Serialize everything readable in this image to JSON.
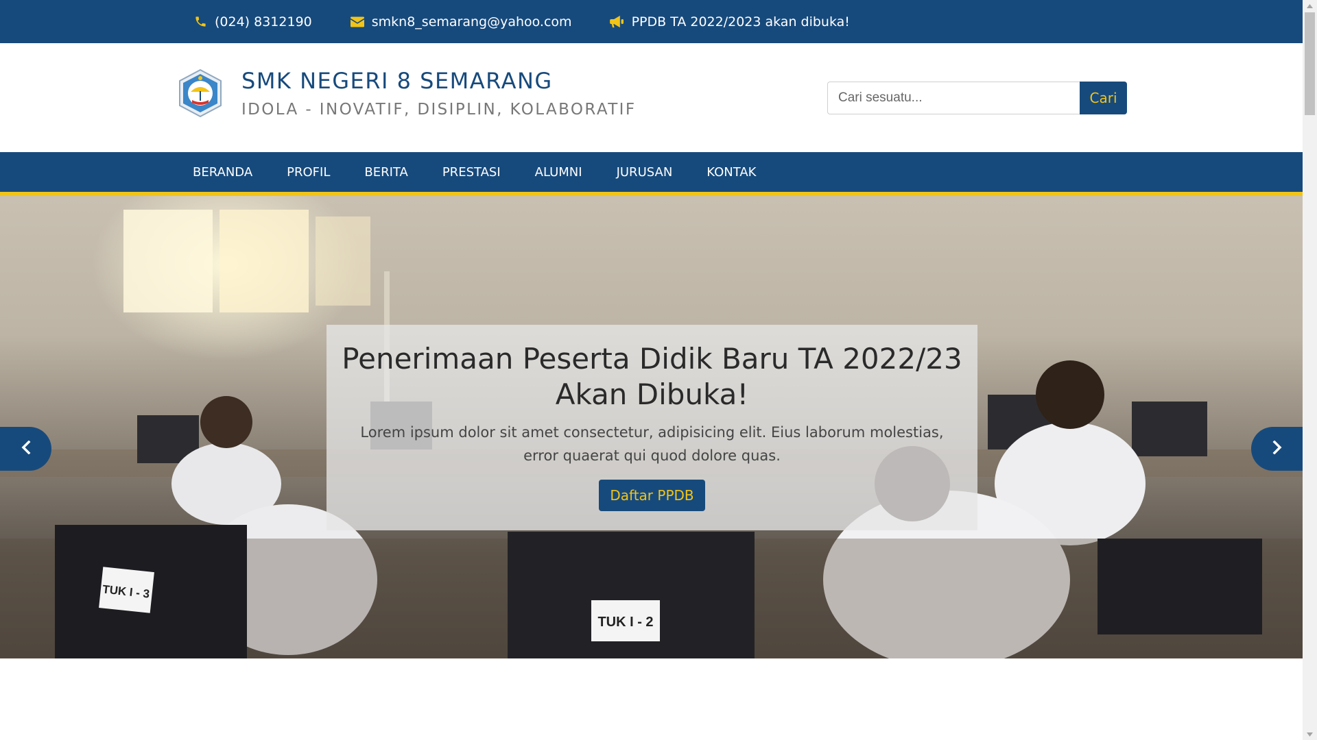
{
  "topbar": {
    "phone": "(024) 8312190",
    "email": "smkn8_semarang@yahoo.com",
    "announcement": "PPDB TA 2022/2023 akan dibuka!"
  },
  "header": {
    "title": "SMK NEGERI 8 SEMARANG",
    "tagline": "IDOLA - INOVATIF, DISIPLIN, KOLABORATIF"
  },
  "search": {
    "placeholder": "Cari sesuatu...",
    "button_label": "Cari"
  },
  "nav": {
    "items": [
      {
        "label": "BERANDA"
      },
      {
        "label": "PROFIL"
      },
      {
        "label": "BERITA"
      },
      {
        "label": "PRESTASI"
      },
      {
        "label": "ALUMNI"
      },
      {
        "label": "JURUSAN"
      },
      {
        "label": "KONTAK"
      }
    ]
  },
  "hero": {
    "title": "Penerimaan Peserta Didik Baru TA 2022/23 Akan Dibuka!",
    "text": "Lorem ipsum dolor sit amet consectetur, adipisicing elit. Eius laborum molestias, error quaerat qui quod dolore quas.",
    "button_label": "Daftar PPDB",
    "photo_labels": [
      "TUK I - 3",
      "TUK I - 2"
    ]
  },
  "icons": {
    "phone": "phone-icon",
    "email": "envelope-icon",
    "announcement": "bullhorn-icon",
    "prev": "chevron-left-icon",
    "next": "chevron-right-icon"
  },
  "colors": {
    "primary": "#174a7c",
    "accent": "#f2c417"
  }
}
